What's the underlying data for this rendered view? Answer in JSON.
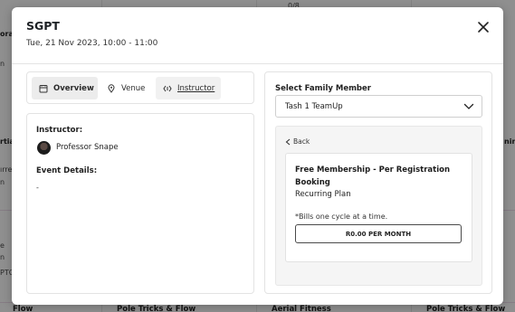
{
  "background": {
    "left_fragments": [
      "orati",
      "n",
      "rtial",
      "ırrell",
      "n",
      "e",
      "n",
      "PTO"
    ],
    "top_center_count": "0/8",
    "right_fragment": "nin",
    "bottom_items": [
      "Pole Tricks & Flow",
      "Pole Tricks & Flow",
      "Aerial Fitness",
      "Pole Tricks & Flow"
    ],
    "bottom_left_fragment": "Flow"
  },
  "modal": {
    "title": "SGPT",
    "datetime": "Tue, 21 Nov 2023, 10:00 - 11:00",
    "tabs": [
      {
        "label": "Overview",
        "icon": "calendar-info-icon",
        "active": true
      },
      {
        "label": "Venue",
        "icon": "location-pin-icon",
        "active": false
      },
      {
        "label": "Instructor",
        "icon": "instructor-icon",
        "active": false
      }
    ],
    "instructor_label": "Instructor:",
    "instructor_name": "Professor Snape",
    "event_details_label": "Event Details:",
    "event_details_text": "-",
    "select_family_label": "Select Family Member",
    "selected_member": "Tash 1 TeamUp",
    "back_label": "Back",
    "plan": {
      "title": "Free Membership - Per Registration Booking",
      "type": "Recurring Plan",
      "note": "*Bills one cycle at a time.",
      "price": "R0.00 PER MONTH"
    }
  }
}
